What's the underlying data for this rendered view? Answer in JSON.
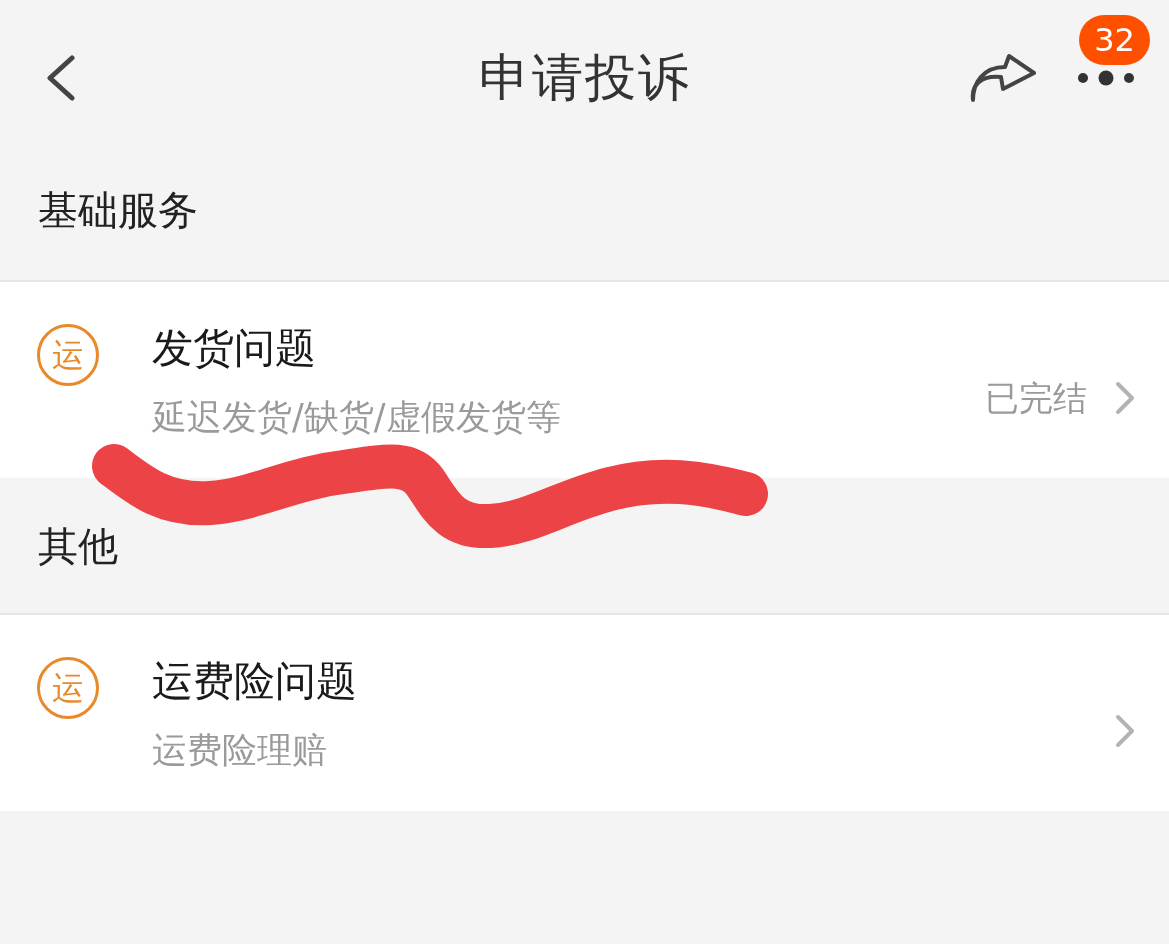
{
  "header": {
    "title": "申请投诉",
    "badge": "32"
  },
  "sections": [
    {
      "heading": "基础服务",
      "items": [
        {
          "icon_text": "运",
          "title": "发货问题",
          "subtitle": "延迟发货/缺货/虚假发货等",
          "status": "已完结"
        }
      ]
    },
    {
      "heading": "其他",
      "items": [
        {
          "icon_text": "运",
          "title": "运费险问题",
          "subtitle": "运费险理赔"
        }
      ]
    }
  ]
}
